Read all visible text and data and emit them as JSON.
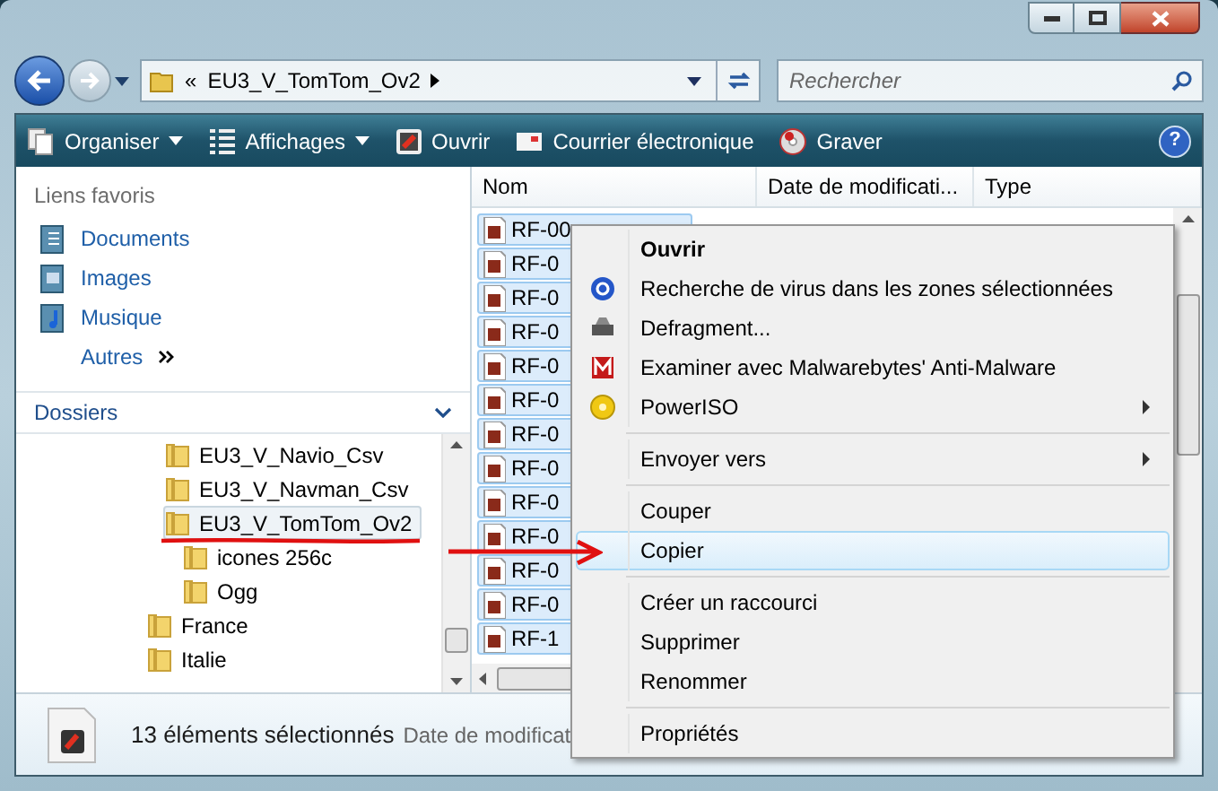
{
  "address_bar": {
    "overflow": "«",
    "path": "EU3_V_TomTom_Ov2"
  },
  "search": {
    "placeholder": "Rechercher"
  },
  "toolbar": [
    {
      "label": "Organiser",
      "dropdown": true
    },
    {
      "label": "Affichages",
      "dropdown": true
    },
    {
      "label": "Ouvrir",
      "dropdown": false
    },
    {
      "label": "Courrier électronique",
      "dropdown": false
    },
    {
      "label": "Graver",
      "dropdown": false
    }
  ],
  "help": "?",
  "favorites": {
    "title": "Liens favoris",
    "items": [
      {
        "kind": "link",
        "label": "Documents"
      },
      {
        "kind": "link",
        "label": "Images"
      },
      {
        "kind": "link",
        "label": "Musique"
      },
      {
        "kind": "more",
        "label": "Autres"
      }
    ]
  },
  "folders": {
    "title": "Dossiers",
    "tree": [
      {
        "label": "EU3_V_Navio_Csv",
        "selected": false
      },
      {
        "label": "EU3_V_Navman_Csv",
        "selected": false
      },
      {
        "label": "EU3_V_TomTom_Ov2",
        "selected": true,
        "children": [
          {
            "label": "icones 256c",
            "selected": false
          },
          {
            "label": "Ogg",
            "selected": false
          }
        ]
      }
    ],
    "tree_parent_level": [
      {
        "label": "France",
        "selected": false
      },
      {
        "label": "Italie",
        "selected": false
      }
    ]
  },
  "file_list": {
    "columns": [
      "Nom",
      "Date de modificati...",
      "Type"
    ],
    "rows": [
      {
        "name": "RF-00",
        "selected": true
      },
      {
        "name": "RF-0",
        "selected": true
      },
      {
        "name": "RF-0",
        "selected": true
      },
      {
        "name": "RF-0",
        "selected": true
      },
      {
        "name": "RF-0",
        "selected": true
      },
      {
        "name": "RF-0",
        "selected": true
      },
      {
        "name": "RF-0",
        "selected": true
      },
      {
        "name": "RF-0",
        "selected": true
      },
      {
        "name": "RF-0",
        "selected": true
      },
      {
        "name": "RF-0",
        "selected": true
      },
      {
        "name": "RF-0",
        "selected": true
      },
      {
        "name": "RF-0",
        "selected": true
      },
      {
        "name": "RF-1",
        "selected": true
      }
    ]
  },
  "context_menu": [
    {
      "kind": "item",
      "label": "Ouvrir",
      "bold": true,
      "submenu": false,
      "selected": false
    },
    {
      "kind": "item",
      "label": "Recherche de virus dans les zones sélectionnées",
      "bold": false,
      "submenu": false,
      "selected": false
    },
    {
      "kind": "item",
      "label": "Defragment...",
      "bold": false,
      "submenu": false,
      "selected": false
    },
    {
      "kind": "item",
      "label": "Examiner avec Malwarebytes' Anti-Malware",
      "bold": false,
      "submenu": false,
      "selected": false
    },
    {
      "kind": "item",
      "label": "PowerISO",
      "bold": false,
      "submenu": true,
      "selected": false
    },
    {
      "kind": "separator"
    },
    {
      "kind": "item",
      "label": "Envoyer vers",
      "bold": false,
      "submenu": true,
      "selected": false
    },
    {
      "kind": "separator"
    },
    {
      "kind": "item",
      "label": "Couper",
      "bold": false,
      "submenu": false,
      "selected": false
    },
    {
      "kind": "item",
      "label": "Copier",
      "bold": false,
      "submenu": false,
      "selected": true
    },
    {
      "kind": "separator"
    },
    {
      "kind": "item",
      "label": "Créer un raccourci",
      "bold": false,
      "submenu": false,
      "selected": false
    },
    {
      "kind": "item",
      "label": "Supprimer",
      "bold": false,
      "submenu": false,
      "selected": false
    },
    {
      "kind": "item",
      "label": "Renommer",
      "bold": false,
      "submenu": false,
      "selected": false
    },
    {
      "kind": "separator"
    },
    {
      "kind": "item",
      "label": "Propriétés",
      "bold": false,
      "submenu": false,
      "selected": false
    }
  ],
  "status_bar": {
    "count": "13 éléments sélectionnés",
    "detail": "Date de modificat"
  }
}
